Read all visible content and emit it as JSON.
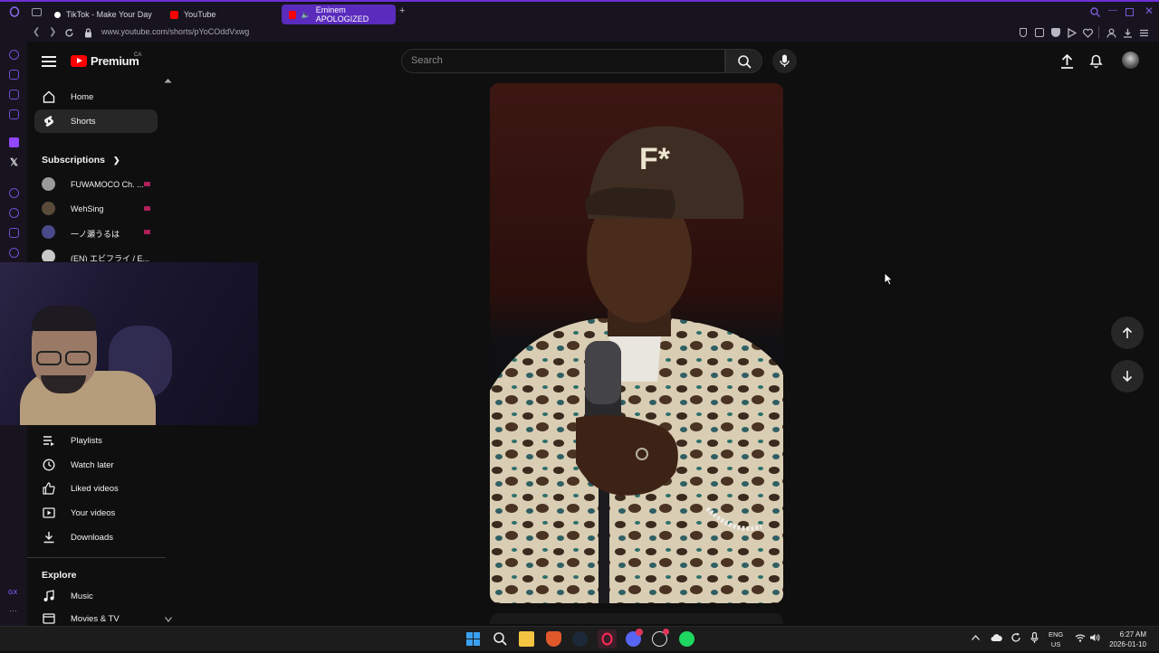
{
  "browser": {
    "tabs": [
      {
        "label": "TikTok - Make Your Day",
        "active": false
      },
      {
        "label": "YouTube",
        "active": false
      },
      {
        "label": "Eminem APOLOGIZED",
        "active": true
      }
    ],
    "url": "www.youtube.com/shorts/pYoCOddVxwg",
    "new_tab": "+"
  },
  "header": {
    "brand": "Premium",
    "country": "CA",
    "search_placeholder": "Search"
  },
  "sidebar": {
    "nav": [
      {
        "label": "Home",
        "icon": "home-icon"
      },
      {
        "label": "Shorts",
        "icon": "shorts-icon",
        "active": true
      }
    ],
    "subscriptions_title": "Subscriptions",
    "subscriptions": [
      {
        "name": "FUWAMOCO Ch. ...",
        "color": "#9a9a9a"
      },
      {
        "name": "WehSing",
        "color": "#5a4a3a"
      },
      {
        "name": "一ノ瀬うるは",
        "color": "#4a4a8a"
      },
      {
        "name": "(EN) エビフライ / E...",
        "color": "#c8c8c8"
      }
    ],
    "you_items": [
      {
        "label": "Playlists",
        "icon": "playlists-icon"
      },
      {
        "label": "Watch later",
        "icon": "watch-later-icon"
      },
      {
        "label": "Liked videos",
        "icon": "liked-videos-icon"
      },
      {
        "label": "Your videos",
        "icon": "your-videos-icon"
      },
      {
        "label": "Downloads",
        "icon": "downloads-icon"
      }
    ],
    "explore_title": "Explore",
    "explore_items": [
      {
        "label": "Music",
        "icon": "music-icon"
      },
      {
        "label": "Movies & TV",
        "icon": "movies-icon"
      }
    ]
  },
  "taskbar": {
    "lang_top": "ENG",
    "lang_bottom": "US",
    "time": "6:27 AM",
    "date": "2026-01-10"
  },
  "colors": {
    "accent": "#6b2fd6",
    "yt_red": "#ff0000",
    "background": "#0f0f0f"
  }
}
